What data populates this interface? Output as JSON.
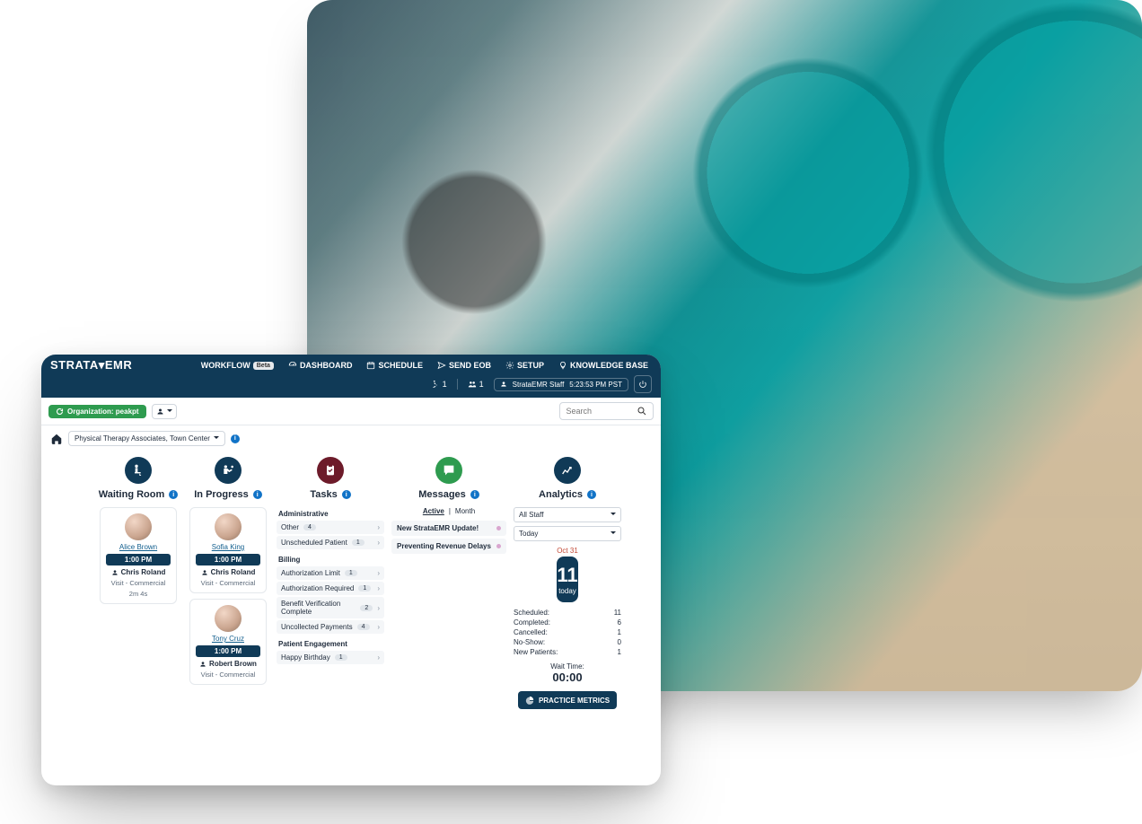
{
  "brand": "STRATA▾EMR",
  "topnav": {
    "workflow": "WORKFLOW",
    "workflow_badge": "Beta",
    "dashboard": "DASHBOARD",
    "schedule": "SCHEDULE",
    "send_eob": "SEND EOB",
    "setup": "SETUP",
    "kb": "KNOWLEDGE BASE"
  },
  "status": {
    "count_a": "1",
    "count_b": "1",
    "user": "StrataEMR Staff",
    "time": "5:23:53 PM PST"
  },
  "subbar": {
    "org_label": "Organization: peakpt",
    "search_placeholder": "Search"
  },
  "breadcrumb": {
    "location": "Physical Therapy Associates, Town Center"
  },
  "columns": {
    "waiting": {
      "title": "Waiting Room",
      "card": {
        "name": "Alice Brown",
        "time": "1:00 PM",
        "provider": "Chris Roland",
        "visit": "Visit - Commercial",
        "duration": "2m 4s"
      }
    },
    "inprogress": {
      "title": "In Progress",
      "cards": [
        {
          "name": "Sofia King",
          "time": "1:00 PM",
          "provider": "Chris Roland",
          "visit": "Visit - Commercial"
        },
        {
          "name": "Tony Cruz",
          "time": "1:00 PM",
          "provider": "Robert Brown",
          "visit": "Visit - Commercial"
        }
      ]
    },
    "tasks": {
      "title": "Tasks",
      "groups": [
        {
          "title": "Administrative",
          "items": [
            {
              "label": "Other",
              "count": "4"
            },
            {
              "label": "Unscheduled Patient",
              "count": "1"
            }
          ]
        },
        {
          "title": "Billing",
          "items": [
            {
              "label": "Authorization Limit",
              "count": "1"
            },
            {
              "label": "Authorization Required",
              "count": "1"
            },
            {
              "label": "Benefit Verification Complete",
              "count": "2"
            },
            {
              "label": "Uncollected Payments",
              "count": "4"
            }
          ]
        },
        {
          "title": "Patient Engagement",
          "items": [
            {
              "label": "Happy Birthday",
              "count": "1"
            }
          ]
        }
      ]
    },
    "messages": {
      "title": "Messages",
      "tabs": {
        "active": "Active",
        "month": "Month"
      },
      "items": [
        "New StrataEMR Update!",
        "Preventing Revenue Delays"
      ]
    },
    "analytics": {
      "title": "Analytics",
      "staff_sel": "All Staff",
      "range_sel": "Today",
      "date": "Oct 31",
      "today_count": "11",
      "today_label": "today",
      "stats": [
        {
          "k": "Scheduled:",
          "v": "11"
        },
        {
          "k": "Completed:",
          "v": "6"
        },
        {
          "k": "Cancelled:",
          "v": "1"
        },
        {
          "k": "No-Show:",
          "v": "0"
        },
        {
          "k": "New Patients:",
          "v": "1"
        }
      ],
      "wait_label": "Wait Time:",
      "wait_value": "00:00",
      "metrics_btn": "PRACTICE METRICS"
    }
  }
}
